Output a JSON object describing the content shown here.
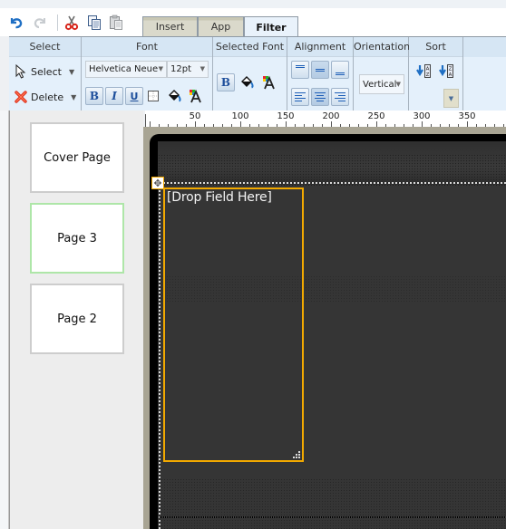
{
  "quick_toolbar": {
    "icons": [
      "undo-icon",
      "redo-icon",
      "cut-icon",
      "copy-icon",
      "paste-icon"
    ]
  },
  "tabs": [
    {
      "label": "Insert",
      "active": false
    },
    {
      "label": "App",
      "active": false
    },
    {
      "label": "Filter",
      "active": true
    }
  ],
  "ribbon": {
    "select": {
      "header": "Select",
      "select_label": "Select",
      "delete_label": "Delete"
    },
    "font": {
      "header": "Font",
      "family": "Helvetica Neue",
      "size": "12pt",
      "bold": "B",
      "italic": "I",
      "underline": "U"
    },
    "selected_font": {
      "header": "Selected Font",
      "bold": "B"
    },
    "alignment": {
      "header": "Alignment"
    },
    "orientation": {
      "header": "Orientation",
      "value": "Vertical"
    },
    "sort": {
      "header": "Sort"
    }
  },
  "ruler": {
    "labels": [
      "50",
      "100",
      "150",
      "200",
      "250",
      "300",
      "350"
    ]
  },
  "pages": [
    {
      "label": "Cover Page",
      "selected": false
    },
    {
      "label": "Page 3",
      "selected": true
    },
    {
      "label": "Page 2",
      "selected": false
    }
  ],
  "canvas": {
    "drop_field_label": "[Drop Field Here]"
  },
  "colors": {
    "selection_accent": "#f2a900",
    "selected_page_border": "#aee6a8",
    "ribbon_bg": "#e4f0fb",
    "canvas_bg": "#353535"
  }
}
